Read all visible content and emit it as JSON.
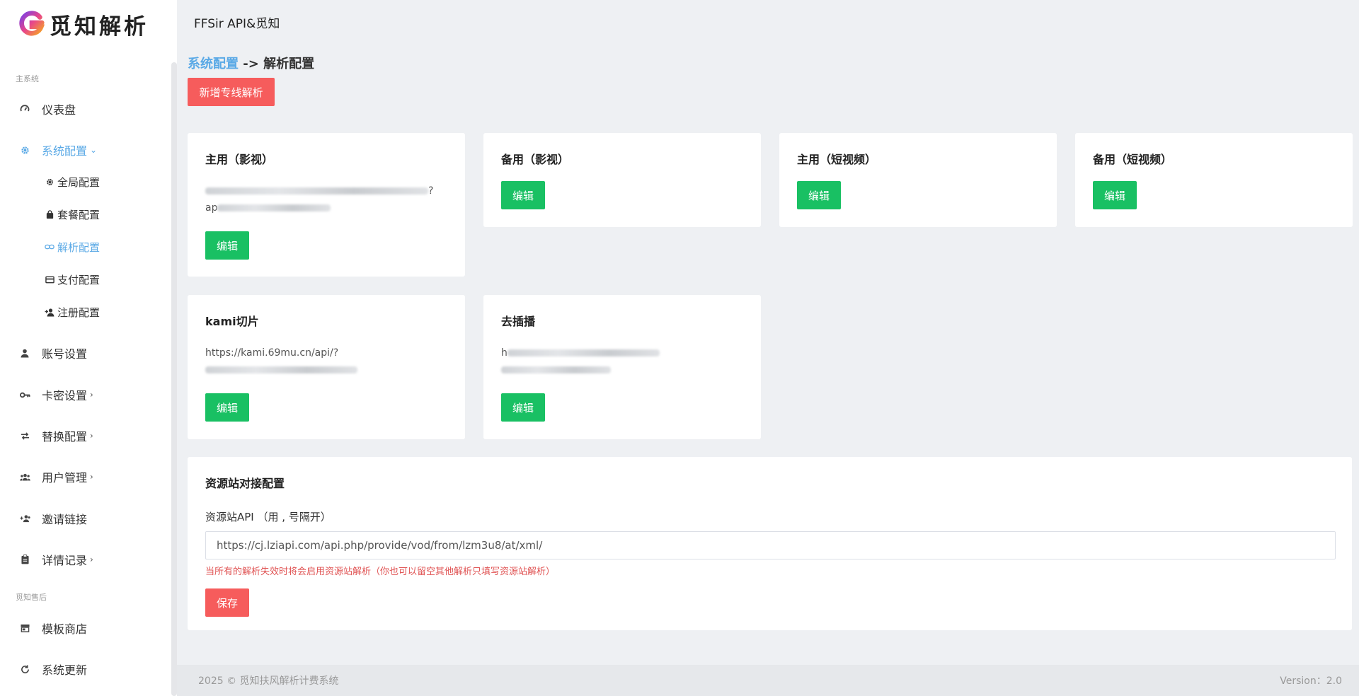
{
  "brand": {
    "name": "觅知解析",
    "logo_icon": "g-gradient-logo-icon"
  },
  "topbar": {
    "title": "FFSir API&觅知"
  },
  "sidebar": {
    "section_main": "主系统",
    "section_after": "觅知售后",
    "items": [
      {
        "label": "仪表盘",
        "icon": "dashboard-icon"
      },
      {
        "label": "系统配置",
        "icon": "gear-icon",
        "expanded": true
      },
      {
        "label": "账号设置",
        "icon": "user-icon"
      },
      {
        "label": "卡密设置",
        "icon": "key-icon"
      },
      {
        "label": "替换配置",
        "icon": "swap-icon"
      },
      {
        "label": "用户管理",
        "icon": "users-icon"
      },
      {
        "label": "邀请链接",
        "icon": "invite-icon"
      },
      {
        "label": "详情记录",
        "icon": "clipboard-icon"
      },
      {
        "label": "模板商店",
        "icon": "store-icon"
      },
      {
        "label": "系统更新",
        "icon": "refresh-icon"
      }
    ],
    "sub_items": [
      {
        "label": "全局配置",
        "icon": "gear-icon"
      },
      {
        "label": "套餐配置",
        "icon": "bag-icon"
      },
      {
        "label": "解析配置",
        "icon": "link-icon",
        "active": true
      },
      {
        "label": "支付配置",
        "icon": "card-icon"
      },
      {
        "label": "注册配置",
        "icon": "user-plus-icon"
      }
    ]
  },
  "breadcrumb": {
    "parent": "系统配置",
    "separator": " -> ",
    "current": "解析配置"
  },
  "add_button": "新增专线解析",
  "cards": [
    {
      "title": "主用（影视）",
      "url_tail": "?",
      "url_line2": "ap"
    },
    {
      "title": "备用（影视）"
    },
    {
      "title": "主用（短视频）"
    },
    {
      "title": "备用（短视频）"
    },
    {
      "title": "kami切片",
      "url_line1": "https://kami.69mu.cn/api/?"
    },
    {
      "title": "去插播",
      "url_line1": "h"
    }
  ],
  "edit_label": "编辑",
  "resource": {
    "title": "资源站对接配置",
    "label": "资源站API （用 , 号隔开）",
    "value": "https://cj.lziapi.com/api.php/provide/vod/from/lzm3u8/at/xml/",
    "hint": "当所有的解析失效时将会启用资源站解析（你也可以留空其他解析只填写资源站解析）",
    "save": "保存"
  },
  "footer": {
    "copyright": "2025 © 觅知扶风解析计费系统",
    "version": "Version：2.0"
  },
  "colors": {
    "accent": "#5aa9e6",
    "green": "#19c063",
    "red": "#f65c5c"
  }
}
